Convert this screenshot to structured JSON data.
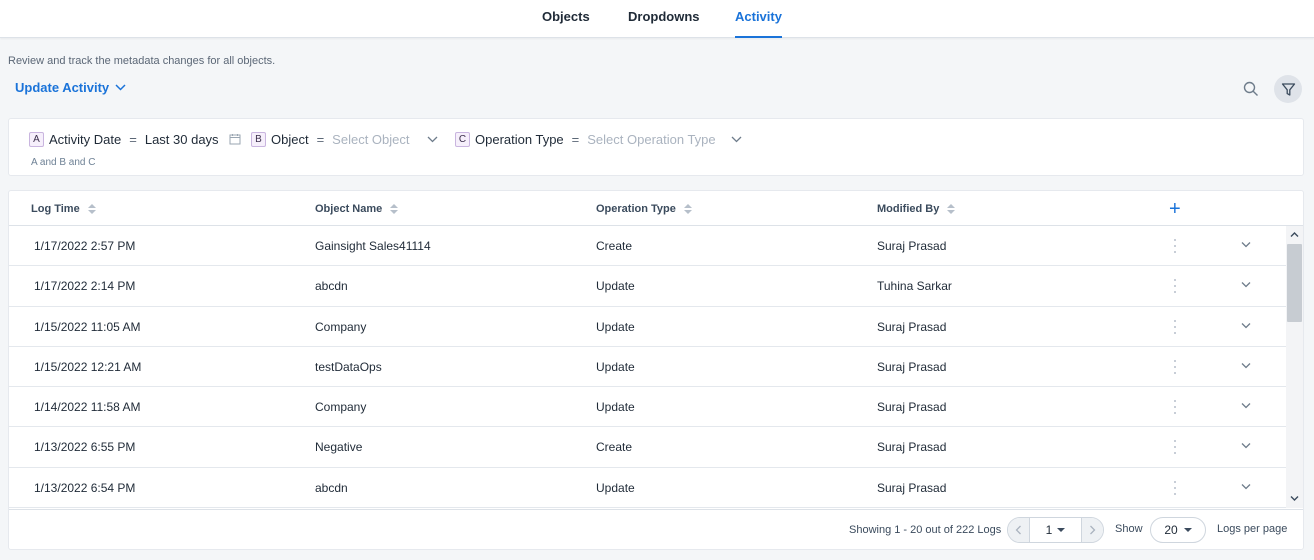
{
  "tabs": [
    {
      "label": "Objects",
      "active": false
    },
    {
      "label": "Dropdowns",
      "active": false
    },
    {
      "label": "Activity",
      "active": true
    }
  ],
  "description": "Review and track the metadata changes for all objects.",
  "view_selector": {
    "label": "Update Activity",
    "icon": "chevron-down-icon"
  },
  "toolbar": {
    "search_icon": "search-icon",
    "filter_icon": "filter-icon"
  },
  "filters": [
    {
      "letter": "A",
      "field": "Activity Date",
      "operator": "=",
      "value": "Last 30 days",
      "icon": "calendar-icon"
    },
    {
      "letter": "B",
      "field": "Object",
      "operator": "=",
      "placeholder": "Select Object",
      "icon": "chevron-down-icon"
    },
    {
      "letter": "C",
      "field": "Operation Type",
      "operator": "=",
      "placeholder": "Select Operation Type",
      "icon": "chevron-down-icon"
    }
  ],
  "filter_logic": "A and B and C",
  "table": {
    "columns": [
      "Log Time",
      "Object Name",
      "Operation Type",
      "Modified By"
    ],
    "add_column_label": "+",
    "rows": [
      [
        "1/17/2022 2:57 PM",
        "Gainsight Sales41114",
        "Create",
        "Suraj Prasad"
      ],
      [
        "1/17/2022 2:14 PM",
        "abcdn",
        "Update",
        "Tuhina Sarkar"
      ],
      [
        "1/15/2022 11:05 AM",
        "Company",
        "Update",
        "Suraj Prasad"
      ],
      [
        "1/15/2022 12:21 AM",
        "testDataOps",
        "Update",
        "Suraj Prasad"
      ],
      [
        "1/14/2022 11:58 AM",
        "Company",
        "Update",
        "Suraj Prasad"
      ],
      [
        "1/13/2022 6:55 PM",
        "Negative",
        "Create",
        "Suraj Prasad"
      ],
      [
        "1/13/2022 6:54 PM",
        "abcdn",
        "Update",
        "Suraj Prasad"
      ]
    ]
  },
  "footer": {
    "showing": "Showing 1 - 20 out of 222 Logs",
    "page": "1",
    "show_label": "Show",
    "per_page": "20",
    "per_page_label": "Logs per page"
  },
  "colors": {
    "accent": "#1a73d9",
    "text": "#1f2a37",
    "muted": "#5b6776",
    "placeholder": "#aab3bf"
  }
}
